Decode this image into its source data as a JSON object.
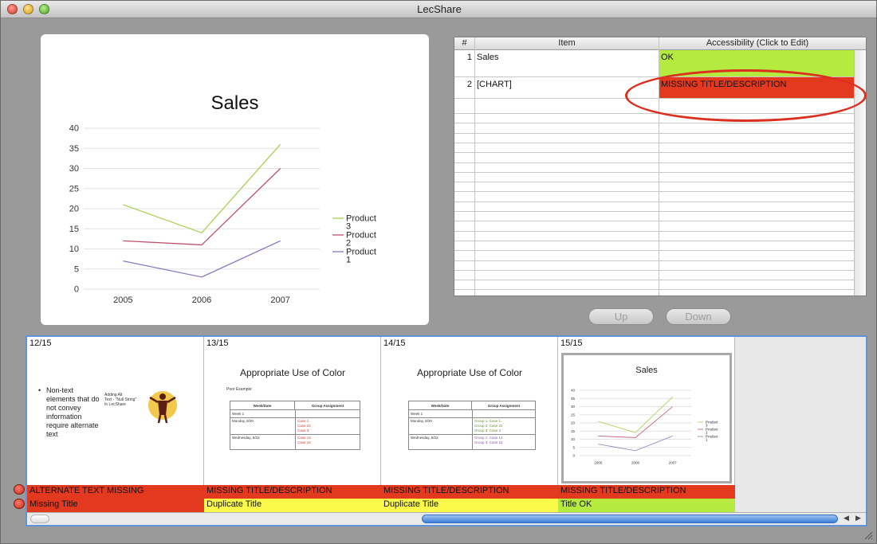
{
  "window": {
    "title": "LecShare"
  },
  "slide": {
    "title": "Sales",
    "chart_data": {
      "type": "line",
      "categories": [
        "2005",
        "2006",
        "2007"
      ],
      "series": [
        {
          "name": "Product 3",
          "values": [
            21,
            14,
            36
          ],
          "color": "#a9cf52"
        },
        {
          "name": "Product 2",
          "values": [
            12,
            11,
            30
          ],
          "color": "#c0506c"
        },
        {
          "name": "Product 1",
          "values": [
            7,
            3,
            12
          ],
          "color": "#8a7bbd"
        }
      ],
      "ylim": [
        0,
        40
      ],
      "yticks": [
        "0",
        "5",
        "10",
        "15",
        "20",
        "25",
        "30",
        "35",
        "40"
      ],
      "legend_labels": [
        "Product\n3",
        "Product\n2",
        "Product\n1"
      ],
      "legend_placement": "right",
      "grid": true
    }
  },
  "table": {
    "headers": {
      "num": "#",
      "item": "Item",
      "accessibility": "Accessibility (Click to Edit)"
    },
    "rows": [
      {
        "num": "1",
        "item": "Sales",
        "accessibility": "OK",
        "status_color": "#b5ea3e"
      },
      {
        "num": "2",
        "item": "[CHART]",
        "accessibility": "MISSING TITLE/DESCRIPTION",
        "status_color": "#e2391f"
      }
    ]
  },
  "buttons": {
    "up": "Up",
    "down": "Down"
  },
  "filmstrip": {
    "slides": [
      {
        "label": "12/15",
        "bullet": "Non-text elements that do not convey information require alternate text",
        "note_lines": [
          "Adding Alt",
          "Text - \"Null String\"",
          "In LecShare"
        ],
        "status1": "ALTERNATE TEXT MISSING",
        "status2": "Missing Title",
        "status2_color": "#e2391f"
      },
      {
        "label": "13/15",
        "title": "Appropriate Use of Color",
        "subtitle": "Poor Example:",
        "table_head": [
          "Week/Date",
          "Group Assignment"
        ],
        "table_rows": [
          [
            "Week 1",
            ""
          ],
          [
            "Monday, 8/20",
            "Case 1\nCase 22\nCase 3"
          ],
          [
            "Wednesday, 8/22",
            "Case 14\nCase 15"
          ]
        ],
        "status1": "MISSING TITLE/DESCRIPTION",
        "status2": "Duplicate Title",
        "status2_color": "#fbfa4b"
      },
      {
        "label": "14/15",
        "title": "Appropriate Use of Color",
        "table_head": [
          "Week/Date",
          "Group Assignment"
        ],
        "table_rows": [
          [
            "Week 1",
            ""
          ],
          [
            "Monday, 8/20",
            "Group 1: Case 1\nGroup 2: Case 22\nGroup 3: Case 3"
          ],
          [
            "Wednesday, 8/22",
            "Group 1: Case 14\nGroup 4: Case 15"
          ]
        ],
        "status1": "MISSING TITLE/DESCRIPTION",
        "status2": "Duplicate Title",
        "status2_color": "#fbfa4b"
      },
      {
        "label": "15/15",
        "title": "Sales",
        "status1": "MISSING TITLE/DESCRIPTION",
        "status2": "Title OK",
        "status2_color": "#b5ea3e"
      }
    ]
  },
  "colors": {
    "status_red": "#e2391f",
    "status_yellow": "#fbfa4b",
    "status_green": "#b5ea3e",
    "annotation_ellipse": "#d9301f",
    "selection_blue": "#5e95d9"
  }
}
